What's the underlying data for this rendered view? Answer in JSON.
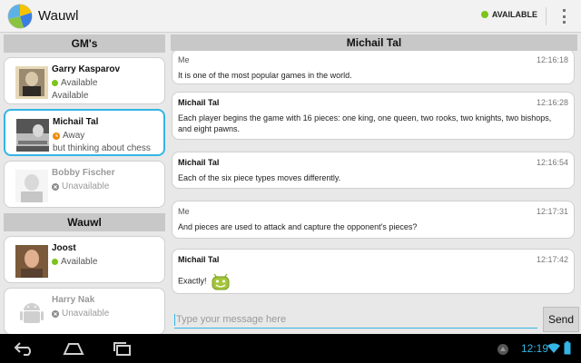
{
  "app": {
    "title": "Wauwl",
    "status_label": "AVAILABLE"
  },
  "sections": [
    {
      "title": "GM's",
      "contacts": [
        {
          "name": "Garry Kasparov",
          "status": "Available",
          "message": "Available",
          "status_color": "#7cc41a",
          "icon": "green-dot-icon"
        },
        {
          "name": "Michail Tal",
          "status": "Away",
          "message": "but thinking about chess",
          "status_color": "#f08a00",
          "icon": "clock-icon"
        },
        {
          "name": "Bobby Fischer",
          "status": "Unavailable",
          "message": "",
          "status_color": "#8a8a8a",
          "icon": "x-circle-icon"
        }
      ]
    },
    {
      "title": "Wauwl",
      "contacts": [
        {
          "name": "Joost",
          "status": "Available",
          "message": "",
          "status_color": "#7cc41a",
          "icon": "green-dot-icon"
        },
        {
          "name": "Harry Nak",
          "status": "Unavailable",
          "message": "",
          "status_color": "#8a8a8a",
          "icon": "x-circle-icon"
        }
      ]
    }
  ],
  "conversation": {
    "title": "Michail Tal",
    "messages": [
      {
        "from": "Me",
        "time": "12:16:18",
        "text": "It is one of the most popular games in the world."
      },
      {
        "from": "Michail Tal",
        "time": "12:16:28",
        "text": "Each player begins the game with 16 pieces: one king, one queen, two rooks, two knights, two bishops, and eight pawns."
      },
      {
        "from": "Michail Tal",
        "time": "12:16:54",
        "text": "Each of the six piece types moves differently."
      },
      {
        "from": "Me",
        "time": "12:17:31",
        "text": "And pieces are used to attack and capture the opponent's pieces?"
      },
      {
        "from": "Michail Tal",
        "time": "12:17:42",
        "text": "Exactly!",
        "emoji": "android-smile-icon"
      }
    ]
  },
  "composer": {
    "placeholder": "Type your message here",
    "send_label": "Send"
  },
  "system": {
    "time": "12:19"
  },
  "colors": {
    "accent": "#33b5e5",
    "available": "#7cc41a",
    "away": "#f08a00"
  }
}
